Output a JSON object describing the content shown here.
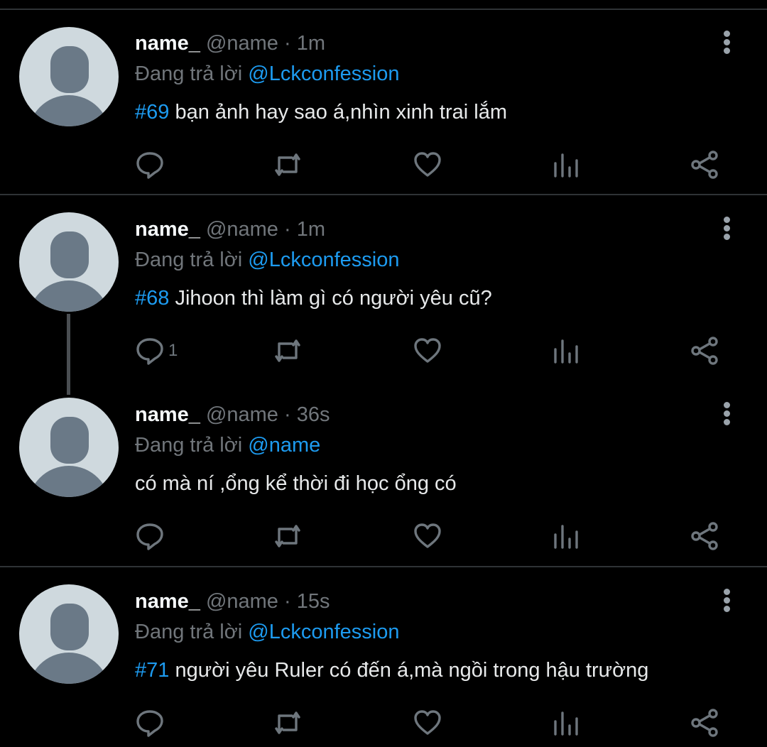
{
  "tweets": [
    {
      "display_name": "name_",
      "handle": "@name",
      "time": "1m",
      "reply_prefix": "Đang trả lời",
      "reply_to": "@Lckconfession",
      "hashtag": "#69",
      "text": "bạn ảnh hay sao á,nhìn xinh trai lắm",
      "reply_count": ""
    },
    {
      "display_name": "name_",
      "handle": "@name",
      "time": "1m",
      "reply_prefix": "Đang trả lời",
      "reply_to": "@Lckconfession",
      "hashtag": "#68",
      "text": "Jihoon thì làm gì có người yêu cũ?",
      "reply_count": "1"
    },
    {
      "display_name": "name_",
      "handle": "@name",
      "time": "36s",
      "reply_prefix": "Đang trả lời",
      "reply_to": "@name",
      "hashtag": "",
      "text": "có mà ní ,ổng kể thời đi học ổng có",
      "reply_count": ""
    },
    {
      "display_name": "name_",
      "handle": "@name",
      "time": "15s",
      "reply_prefix": "Đang trả lời",
      "reply_to": "@Lckconfession",
      "hashtag": "#71",
      "text": "người yêu Ruler có đến á,mà ngồi trong hậu trường",
      "reply_count": ""
    }
  ],
  "separator": "·",
  "icons": [
    "reply-icon",
    "retweet-icon",
    "like-icon",
    "analytics-icon",
    "share-icon",
    "more-icon"
  ],
  "colors": {
    "background": "#000000",
    "link": "#1d9bf0",
    "secondary_text": "#71767b",
    "avatar_bg": "#cfd9de",
    "avatar_fg": "#6a7987"
  }
}
